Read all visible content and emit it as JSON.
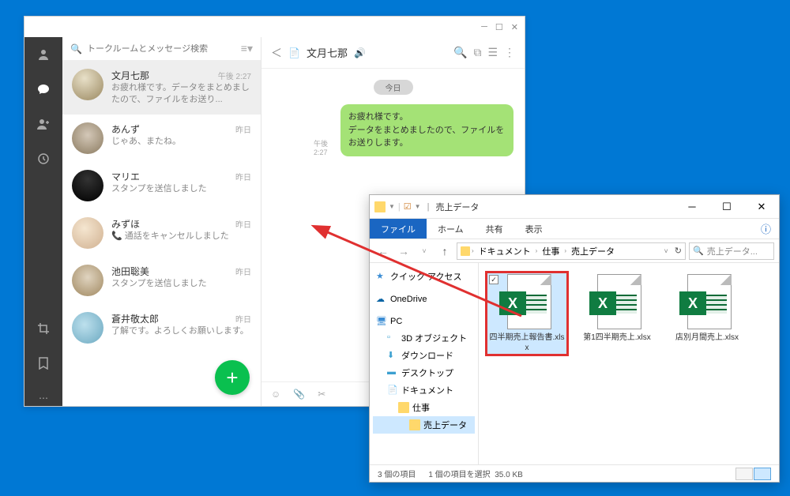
{
  "chat": {
    "search_placeholder": "トークルームとメッセージ検索",
    "entries": [
      {
        "name": "文月七那",
        "time": "午後 2:27",
        "preview": "お疲れ様です。データをまとめましたので、ファイルをお送り..."
      },
      {
        "name": "あんず",
        "time": "昨日",
        "preview": "じゃあ、またね。"
      },
      {
        "name": "マリエ",
        "time": "昨日",
        "preview": "スタンプを送信しました"
      },
      {
        "name": "みずほ",
        "time": "昨日",
        "preview": "📞 通話をキャンセルしました"
      },
      {
        "name": "池田聡美",
        "time": "昨日",
        "preview": "スタンプを送信しました"
      },
      {
        "name": "蒼井敬太郎",
        "time": "昨日",
        "preview": "了解です。よろしくお願いします。"
      }
    ],
    "conv": {
      "name": "文月七那",
      "date": "今日",
      "msg_text": "お疲れ様です。\nデータをまとめましたので、ファイルをお送りします。",
      "msg_time": "午後 2:27"
    }
  },
  "explorer": {
    "title": "売上データ",
    "ribbon": {
      "file": "ファイル",
      "home": "ホーム",
      "share": "共有",
      "view": "表示"
    },
    "breadcrumb": [
      "ドキュメント",
      "仕事",
      "売上データ"
    ],
    "search_placeholder": "売上データ...",
    "tree": {
      "quick": "クイック アクセス",
      "onedrive": "OneDrive",
      "pc": "PC",
      "3d": "3D オブジェクト",
      "downloads": "ダウンロード",
      "desktop": "デスクトップ",
      "documents": "ドキュメント",
      "work": "仕事",
      "salesdata": "売上データ"
    },
    "files": [
      {
        "name": "四半期売上報告書.xlsx"
      },
      {
        "name": "第1四半期売上.xlsx"
      },
      {
        "name": "店別月間売上.xlsx"
      }
    ],
    "status": {
      "count": "3 個の項目",
      "selected": "1 個の項目を選択",
      "size": "35.0 KB"
    }
  }
}
